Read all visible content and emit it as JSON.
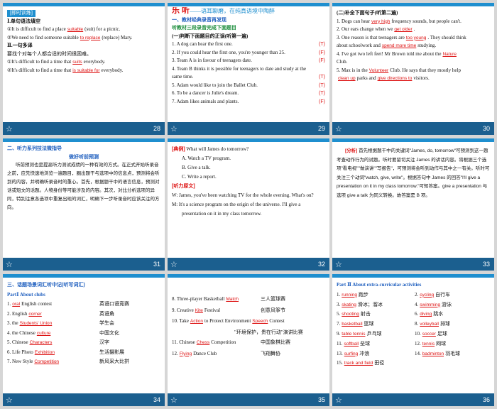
{
  "footer_icon": "star-icon",
  "slides": [
    {
      "page": "28",
      "tag": "[即时训练]",
      "lines": [
        {
          "t": "Ⅰ.单句语法填空"
        },
        {
          "pre": "①It is difficult to find a place",
          "ans": "suitable",
          "post": "(suit) for a picnic."
        },
        {
          "pre": "②We need to find someone suitable",
          "ans": "to replace",
          "post": "(replace) Mary."
        },
        {
          "t": "Ⅱ.一句多译"
        },
        {
          "t": "要找个对每个人都合适的时间很困难。"
        },
        {
          "pre": "①It's difficult to find a time that",
          "ans": "suits",
          "post": "everybody."
        },
        {
          "pre": "②It's difficult to find a time that",
          "ans": "is suitable for",
          "post": "everybody."
        }
      ]
    },
    {
      "page": "29",
      "big_title": "乐 听",
      "big_sub": "——语耳聊磨，在纯真语境中陶醉",
      "head1": "一、教材经典录音再发现",
      "head2": "听教材三段录音完成下面题目",
      "head3": "(一)判断下面题目的正误(听第一遍)",
      "items": [
        {
          "q": "1. A dog can hear the first one.",
          "a": "(T)"
        },
        {
          "q": "2. If you could hear the first one, you're younger than 25.",
          "a": "(F)"
        },
        {
          "q": "3. Team A is in favour of teenagers date.",
          "a": "(F)"
        },
        {
          "q": "4. Team B thinks it is possible for teenagers to date and study at the same time.",
          "a": "(T)"
        },
        {
          "q": "5. Adam would like to join the Ballet Club.",
          "a": "(T)"
        },
        {
          "q": "6. To be a dancer is Julie's dream.",
          "a": "(T)"
        },
        {
          "q": "7. Adam likes animals and plants.",
          "a": "(F)"
        }
      ]
    },
    {
      "page": "30",
      "head": "(二)补全下面句子(听第二遍)",
      "lines": [
        {
          "pre": "1. Dogs can hear",
          "ans": "very high",
          "post": "frequency sounds, but people can't."
        },
        {
          "pre": "2. Our ears change when we",
          "ans": "get older",
          "post": "."
        },
        {
          "pre": "3. One reason is that teenagers are",
          "ans": "too young",
          "post": ". They should think"
        },
        {
          "pre": "about schoolwork and",
          "ans": "spend more time",
          "post": "studying."
        },
        {
          "pre": "4. I've got two left feet! Mr Brown told me about the",
          "ans": "Nature",
          "post": ""
        },
        {
          "t": "Club."
        },
        {
          "pre": "5. Max is in the",
          "ans": "Volunteer",
          "post": "Club. He says that they mostly help"
        },
        {
          "pre": "",
          "ans": "clean up",
          "post": "parks and"
        },
        {
          "pre": "",
          "ans": "give directions to",
          "post": "visitors."
        }
      ]
    },
    {
      "page": "31",
      "head": "二、听力系列技法微指导",
      "sub": "做好听前预测",
      "para": "听前预测也是提高听力测试成绩的一种有效的方式。在正式开始听录音之前，应先快速地浏览一遍题目，圈出题干与选项中的信息点，预测将会听到的内容，并明确听录音时的重心。首先，根据题干中的语言信息，预测对话或短文的话题。人物身份等可能涉及的内容。其次，对比分析选项的异同，特别注意各选项中重复出现的词汇，明确下一步听录音时应该关注的方向。"
    },
    {
      "page": "32",
      "example_tag": "[典例]",
      "question": "What will James do tomorrow?",
      "options": [
        "A. Watch a TV program.",
        "B. Give a talk.",
        "C. Write a report."
      ],
      "script_tag": "[听力原文]",
      "script": [
        "W: James, you've been watching TV for the whole evening. What's on?",
        "M: It's a science program on the origin of the universe. I'll give a presentation on it in my class tomorrow."
      ]
    },
    {
      "page": "33",
      "tag": "[分析]",
      "para": "首先根据题干中的关键词\"James, do, tomorrow\"可预测到这一题考查动作行为的试题。听时要留切关注 James 的讲话内容。将根据三个选项\"看电视\"\"做演讲\"\"写报告\"，可预测将会听到动作与其中之一有关。听时可关注三个动词\"watch, give, write\"。根据答句中 James 的回答\"I'll give a presentation on it in my class tomorrow.\"可知答案。give a presentation 与选项 give a talk 为同义转换。故答案是 B 项。"
    },
    {
      "page": "34",
      "head": "三、话题场景词汇听中记(听写词汇)",
      "part": "PartⅠ  About clubs",
      "rows": [
        {
          "n": "1.",
          "ans": "oral",
          "en": "English contest",
          "cn": "英语口语竞赛"
        },
        {
          "n": "2.",
          "en": "English",
          "ans": "corner",
          "cn": "英语角"
        },
        {
          "n": "3.",
          "en": "the",
          "ans": "Students' Union",
          "cn": "学生会"
        },
        {
          "n": "4.",
          "en": "the Chinese",
          "ans": "culture",
          "cn": "中国文化"
        },
        {
          "n": "5.",
          "en": "Chinese",
          "ans": "Characters",
          "cn": "汉字"
        },
        {
          "n": "6.",
          "en": "Life Photo",
          "ans": "Exhibition",
          "cn": "生活摄影展"
        },
        {
          "n": "7.",
          "en": "New Style",
          "ans": "Competition",
          "cn": "新风采大比拼"
        }
      ]
    },
    {
      "page": "35",
      "rows": [
        {
          "pre": "8. Three-player Basketball",
          "ans": "Match",
          "post": "",
          "cn": "三人篮球赛"
        },
        {
          "pre": "9. Creative",
          "ans": "Kite",
          "post": "Festival",
          "cn": "创意风筝节"
        },
        {
          "pre": "10. Take",
          "ans": "Action",
          "post": "to Protect Environment",
          "ans2": "Speech",
          "post2": "Contest",
          "cn": ""
        },
        {
          "pre": "",
          "ans": "",
          "post": "",
          "cn": "\"环境保护，贵在行动\"演讲比赛"
        },
        {
          "pre": "11. Chinese",
          "ans": "Chess",
          "post": "Competition",
          "cn": "中国象棋比赛"
        },
        {
          "pre": "12.",
          "ans": "Flying",
          "post": "Dance Club",
          "cn": "飞翔舞协"
        }
      ]
    },
    {
      "page": "36",
      "part": "Part Ⅱ  About extra-curricular activities",
      "rows": [
        {
          "l_n": "1.",
          "l_ans": "running",
          "l_cn": "跑步",
          "r_n": "2.",
          "r_ans": "cycling",
          "r_cn": "自行车"
        },
        {
          "l_n": "3.",
          "l_ans": "skating",
          "l_cn": "滑冰；溜冰",
          "r_n": "4.",
          "r_ans": "swimming",
          "r_cn": "游泳"
        },
        {
          "l_n": "5.",
          "l_ans": "shooting",
          "l_cn": "射击",
          "r_n": "6.",
          "r_ans": "diving",
          "r_cn": "跳水"
        },
        {
          "l_n": "7.",
          "l_ans": "basketball",
          "l_cn": "篮球",
          "r_n": "8.",
          "r_ans": "volleyball",
          "r_cn": "排球"
        },
        {
          "l_n": "9.",
          "l_ans": "table tennis",
          "l_cn": "乒乓球",
          "r_n": "10.",
          "r_ans": "soccer",
          "r_cn": "足球"
        },
        {
          "l_n": "11.",
          "l_ans": "softball",
          "l_cn": "垒球",
          "r_n": "12.",
          "r_ans": "tennis",
          "r_cn": "网球"
        },
        {
          "l_n": "13.",
          "l_ans": "surfing",
          "l_cn": "冲浪",
          "r_n": "14.",
          "r_ans": "badminton",
          "r_cn": "羽毛球"
        },
        {
          "l_n": "15.",
          "l_ans": "track and field",
          "l_cn": "田径",
          "r_n": "",
          "r_ans": "",
          "r_cn": ""
        }
      ]
    }
  ]
}
